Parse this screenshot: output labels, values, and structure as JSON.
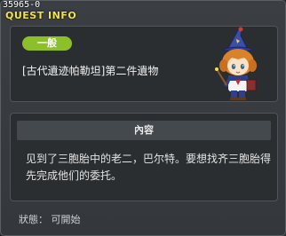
{
  "window": {
    "quest_id": "35965-0",
    "title": "QUEST INFO"
  },
  "quest": {
    "category_badge": "一般",
    "name": "[古代遺迹帕勒坦]第二件遺物"
  },
  "content_section": {
    "header": "內容",
    "description": "见到了三胞胎中的老二，巴尔特。要想找齐三胞胎得先完成他们的委托。"
  },
  "status_text": "狀態：  可開始",
  "colors": {
    "title": "#f0e34a",
    "badge": "#8cbf2a",
    "panel_bg": "#2b2e31",
    "window_bg": "#3b3f43"
  }
}
